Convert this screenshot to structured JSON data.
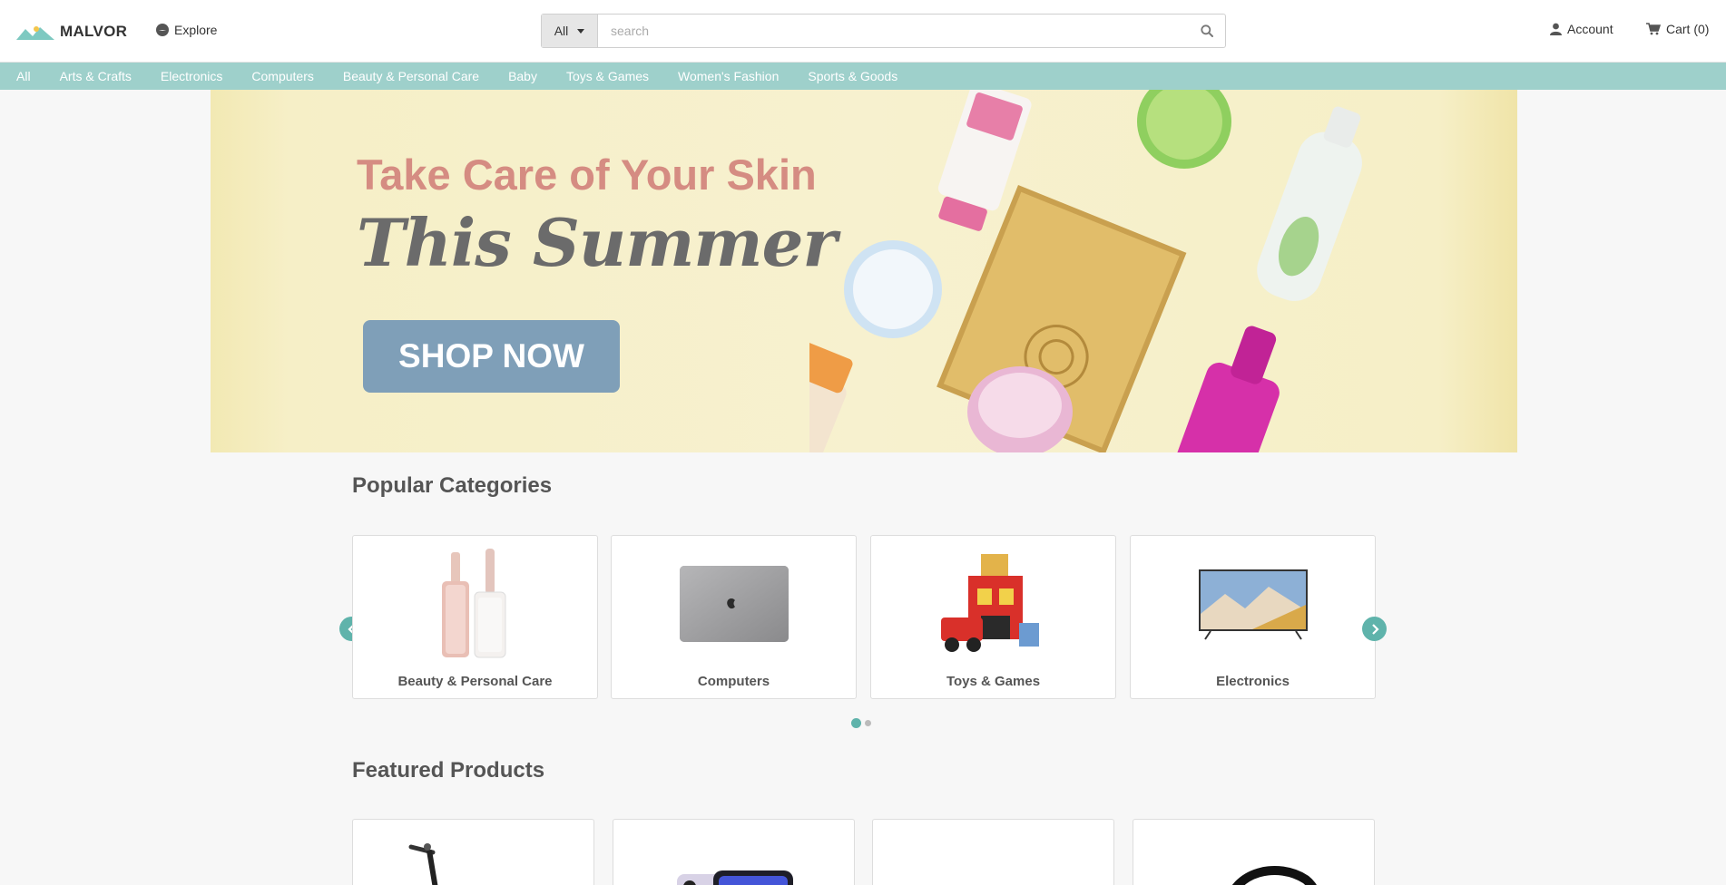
{
  "header": {
    "brand": "MALVOR",
    "explore_label": "Explore",
    "search": {
      "category": "All",
      "placeholder": "search"
    },
    "account_label": "Account",
    "cart_label": "Cart (0)"
  },
  "category_nav": [
    "All",
    "Arts & Crafts",
    "Electronics",
    "Computers",
    "Beauty & Personal Care",
    "Baby",
    "Toys & Games",
    "Women's Fashion",
    "Sports & Goods"
  ],
  "hero": {
    "title": "Take Care of Your Skin",
    "subtitle": "This Summer",
    "cta": "SHOP NOW"
  },
  "popular_categories": {
    "title": "Popular Categories",
    "items": [
      {
        "label": "Beauty & Personal Care",
        "icon": "lip-gloss-image"
      },
      {
        "label": "Computers",
        "icon": "laptop-image"
      },
      {
        "label": "Toys & Games",
        "icon": "fire-station-toy-image"
      },
      {
        "label": "Electronics",
        "icon": "tv-image"
      }
    ],
    "page_count": 2,
    "active_page": 1
  },
  "featured_products": {
    "title": "Featured Products",
    "items": [
      {
        "icon": "scooter-image"
      },
      {
        "icon": "smartphone-image"
      },
      {
        "icon": "blank-image"
      },
      {
        "icon": "cable-image"
      }
    ]
  },
  "colors": {
    "nav_bar": "#9ed0cb",
    "accent": "#5fb3ab",
    "hero_bg": "#f7f1cf",
    "hero_title": "#d58c82",
    "hero_button": "#7f9fb8"
  }
}
